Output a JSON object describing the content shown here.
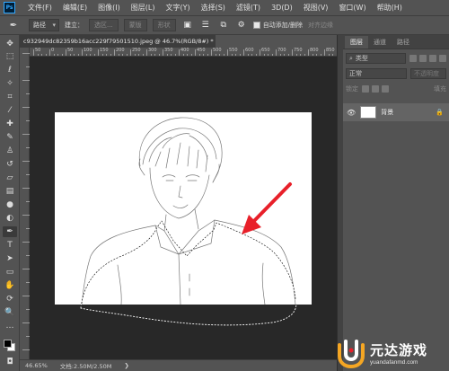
{
  "app": {
    "logo_text": "Ps"
  },
  "menu": [
    "文件(F)",
    "编辑(E)",
    "图像(I)",
    "图层(L)",
    "文字(Y)",
    "选择(S)",
    "滤镜(T)",
    "3D(D)",
    "视图(V)",
    "窗口(W)",
    "帮助(H)"
  ],
  "options_bar": {
    "mode_value": "路径",
    "make_label": "建立：",
    "selection_button": "选区...",
    "mask_button": "蒙版",
    "shape_button": "形状",
    "auto_add_delete_label": "自动添加/删除",
    "align_edges_label": "对齐边缘"
  },
  "document": {
    "tab_title": "c932949dc82359b16acc229f79501510.jpeg @ 46.7%(RGB/8#) *",
    "zoom": "46.65%",
    "doc_info": "文档:2.50M/2.50M"
  },
  "rulers": {
    "top_labels": [
      "50",
      "0",
      "50",
      "100",
      "150",
      "200",
      "250",
      "300",
      "350",
      "400",
      "450",
      "500",
      "550",
      "600",
      "650",
      "700",
      "750",
      "800",
      "850"
    ]
  },
  "layers_panel": {
    "tabs": [
      "图层",
      "通道",
      "路径"
    ],
    "kind_filter": "类型",
    "blend_mode": "正常",
    "opacity_label": "不透明度",
    "fill_label": "填充",
    "lock_label": "锁定",
    "layers": [
      {
        "name": "背景"
      }
    ]
  },
  "watermark": {
    "title": "元达游戏",
    "url": "yuandafanmd.com"
  },
  "colors": {
    "accent": "#31a8ff",
    "arrow": "#e8202a",
    "canvas_bg": "#282828",
    "panel_bg": "#535353"
  }
}
